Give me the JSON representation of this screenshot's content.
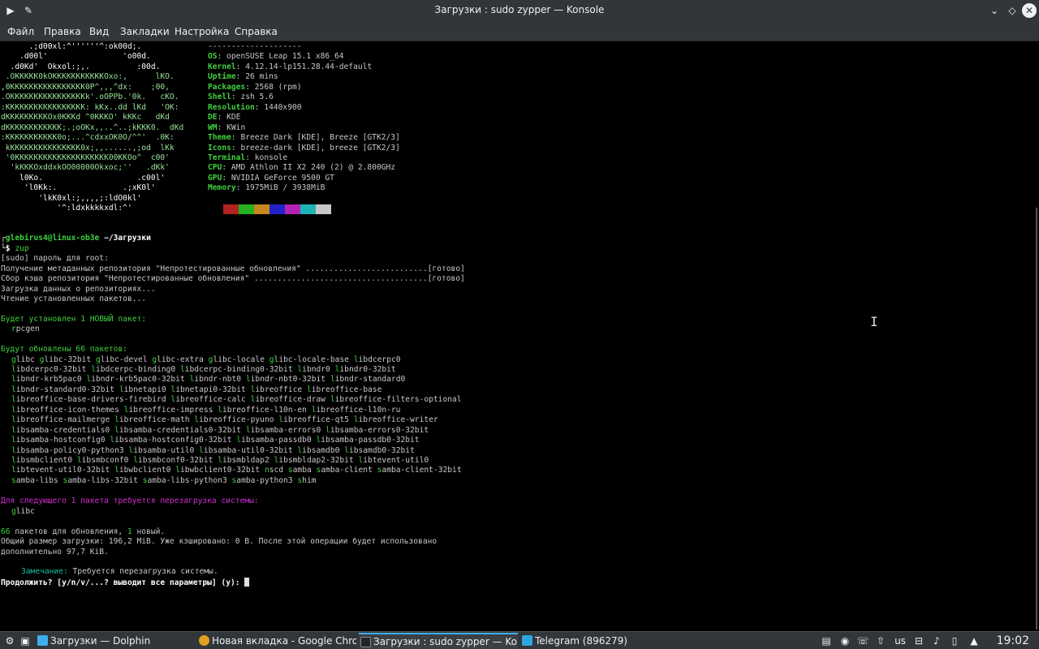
{
  "window": {
    "title": "Загрузки : sudo zypper — Konsole"
  },
  "menu": [
    "Файл",
    "Правка",
    "Вид",
    "Закладки",
    "Настройка",
    "Справка"
  ],
  "logo_lines": [
    "      .;d00xl:^''''''^:ok00d;.",
    "    .d00l'                'o00d.",
    "  .d0Kd'  Okxol:;,.          :00d.",
    " .OKKKKK0kOKKKKKKKKKKKOxo:,      lKO.",
    ",0KKKKKKKKKKKKKKKK0P^,,,^dx:    ;00,",
    ".OKKKKKKKKKKKKKKKKk'.oOPPb.'0k.   cKO.",
    ":KKKKKKKKKKKKKKKKK: kKx..dd lKd   'OK:",
    "dKKKKKKKKKOx0KKKd ^0KKKO' kKKc   dKd",
    "dKKKKKKKKKKKK;.;oOKx,,..^..;kKKK0.  dKd",
    ":KKKKKKKKKKK0o;...^cdxxOK0O/^^'  .0K:",
    " kKKKKKKKKKKKKKKK0x;,,......,;od  lKk",
    " '0KKKKKKKKKKKKKKKKKKKK00KKOo^  c00'",
    "  'kKKKOxddxkOO00000Okxoc;''   .dKk'",
    "    l0Ko.                    .c00l'",
    "     'l0Kk:.              .;xK0l'",
    "        'lkK0xl:;,,,,;:ldO0kl'",
    "            '^:ldxkkkkxdl:^'"
  ],
  "sysinfo": [
    {
      "key": "",
      "value": "--------------------"
    },
    {
      "key": "OS",
      "value": "openSUSE Leap 15.1 x86_64"
    },
    {
      "key": "Kernel",
      "value": "4.12.14-lp151.28.44-default"
    },
    {
      "key": "Uptime",
      "value": "26 mins"
    },
    {
      "key": "Packages",
      "value": "2568 (rpm)"
    },
    {
      "key": "Shell",
      "value": "zsh 5.6"
    },
    {
      "key": "Resolution",
      "value": "1440x900"
    },
    {
      "key": "DE",
      "value": "KDE"
    },
    {
      "key": "WM",
      "value": "KWin"
    },
    {
      "key": "Theme",
      "value": "Breeze Dark [KDE], Breeze [GTK2/3]"
    },
    {
      "key": "Icons",
      "value": "breeze-dark [KDE], breeze [GTK2/3]"
    },
    {
      "key": "Terminal",
      "value": "konsole"
    },
    {
      "key": "CPU",
      "value": "AMD Athlon II X2 240 (2) @ 2.800GHz"
    },
    {
      "key": "GPU",
      "value": "NVIDIA GeForce 9500 GT"
    },
    {
      "key": "Memory",
      "value": "1975MiB / 3938MiB"
    }
  ],
  "palette": [
    "#b22222",
    "#22b222",
    "#c8861e",
    "#2222c8",
    "#b422b4",
    "#1eb4b4",
    "#c8c8c8"
  ],
  "prompt": {
    "user_host": "glebirus4@linux-ob3e",
    "path": "~/Загрузки",
    "dollar": "$",
    "command": "zup"
  },
  "output": {
    "sudo": "[sudo] пароль для root:",
    "meta": "Получение метаданных репозитория \"Непротестированные обновления\" ..........................[готово]",
    "cache": "Сбор кэша репозитория \"Непротестированные обновления\" .....................................[готово]",
    "load": "Загрузка данных о репозиториях...",
    "read": "Чтение установленных пакетов...",
    "new_header": "Будет установлен 1 НОВЫЙ пакет:",
    "new_pkg": "rpcgen",
    "upd_header": "Будут обновлены 66 пакетов:",
    "upd_lines": [
      "glibc glibc-32bit glibc-devel glibc-extra glibc-locale glibc-locale-base libdcerpc0",
      "libdcerpc0-32bit libdcerpc-binding0 libdcerpc-binding0-32bit libndr0 libndr0-32bit",
      "libndr-krb5pac0 libndr-krb5pac0-32bit libndr-nbt0 libndr-nbt0-32bit libndr-standard0",
      "libndr-standard0-32bit libnetapi0 libnetapi0-32bit libreoffice libreoffice-base",
      "libreoffice-base-drivers-firebird libreoffice-calc libreoffice-draw libreoffice-filters-optional",
      "libreoffice-icon-themes libreoffice-impress libreoffice-l10n-en libreoffice-l10n-ru",
      "libreoffice-mailmerge libreoffice-math libreoffice-pyuno libreoffice-qt5 libreoffice-writer",
      "libsamba-credentials0 libsamba-credentials0-32bit libsamba-errors0 libsamba-errors0-32bit",
      "libsamba-hostconfig0 libsamba-hostconfig0-32bit libsamba-passdb0 libsamba-passdb0-32bit",
      "libsamba-policy0-python3 libsamba-util0 libsamba-util0-32bit libsamdb0 libsamdb0-32bit",
      "libsmbclient0 libsmbconf0 libsmbconf0-32bit libsmbldap2 libsmbldap2-32bit libtevent-util0",
      "libtevent-util0-32bit libwbclient0 libwbclient0-32bit nscd samba samba-client samba-client-32bit",
      "samba-libs samba-libs-32bit samba-libs-python3 samba-python3 shim"
    ],
    "reboot_header": "Для следующего 1 пакета требуется перезагрузка системы:",
    "reboot_pkg": "glibc",
    "summary_count": "66",
    "summary_mid": " пакетов для обновления, ",
    "summary_new": "1",
    "summary_end": " новый.",
    "size_line": "Общий размер загрузки: 196,2 MiB. Уже кэшировано: 0 B. После этой операции будет использовано",
    "size_line2": "дополнительно 97,7 KiB.",
    "note_label": "Замечание:",
    "note_text": " Требуется перезагрузка системы.",
    "question": "Продолжить? [y/n/v/...? выводит все параметры] (y): "
  },
  "taskbar": {
    "tasks": [
      "Загрузки — Dolphin",
      "Новая вкладка - Google Chrome",
      "Загрузки : sudo zypper — Konsole",
      "Telegram (896279)"
    ],
    "layout": "us",
    "clock": "19:02"
  },
  "colors": {
    "accent": "#3daee9",
    "term_green": "#3fd23f",
    "term_magenta": "#d12dd1",
    "term_blue": "#2fb4ff"
  }
}
